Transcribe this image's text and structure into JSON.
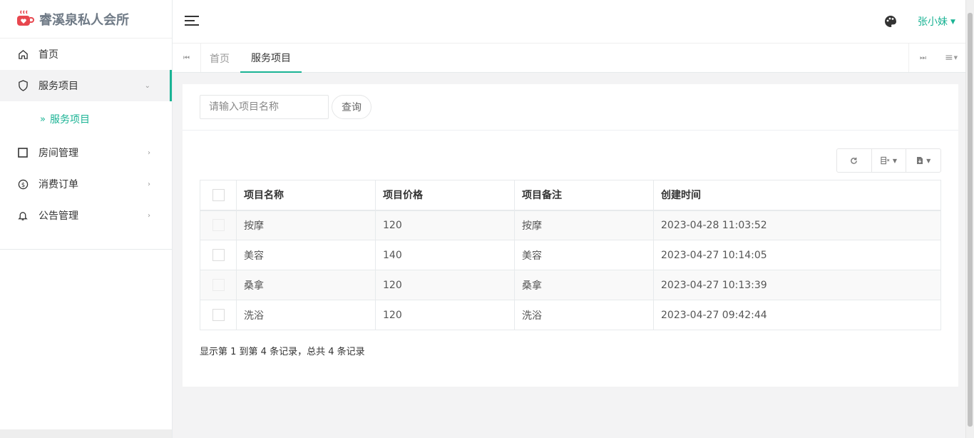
{
  "app": {
    "title": "睿溪泉私人会所"
  },
  "sidebar": {
    "items": [
      {
        "label": "首页",
        "icon": "home-icon"
      },
      {
        "label": "服务项目",
        "icon": "shield-icon",
        "open": true
      },
      {
        "label": "房间管理",
        "icon": "square-icon"
      },
      {
        "label": "消费订单",
        "icon": "dollar-circle-icon"
      },
      {
        "label": "公告管理",
        "icon": "bell-icon"
      }
    ],
    "sub_item": {
      "label": "服务项目",
      "prefix": "»"
    }
  },
  "header": {
    "user_name": "张小妹",
    "theme_icon": "palette-icon"
  },
  "tabs": {
    "home": "首页",
    "active": "服务项目"
  },
  "search": {
    "placeholder": "请输入项目名称",
    "button_label": "查询"
  },
  "toolbar": [
    "refresh-icon",
    "columns-icon",
    "export-icon"
  ],
  "table": {
    "columns": [
      "项目名称",
      "项目价格",
      "项目备注",
      "创建时间"
    ],
    "rows": [
      [
        "按摩",
        "120",
        "按摩",
        "2023-04-28 11:03:52"
      ],
      [
        "美容",
        "140",
        "美容",
        "2023-04-27 10:14:05"
      ],
      [
        "桑拿",
        "120",
        "桑拿",
        "2023-04-27 10:13:39"
      ],
      [
        "洗浴",
        "120",
        "洗浴",
        "2023-04-27 09:42:44"
      ]
    ]
  },
  "pagination": {
    "summary": "显示第 1 到第 4 条记录，总共 4 条记录"
  },
  "colors": {
    "accent": "#1ab394",
    "logo": "#e8474f"
  }
}
